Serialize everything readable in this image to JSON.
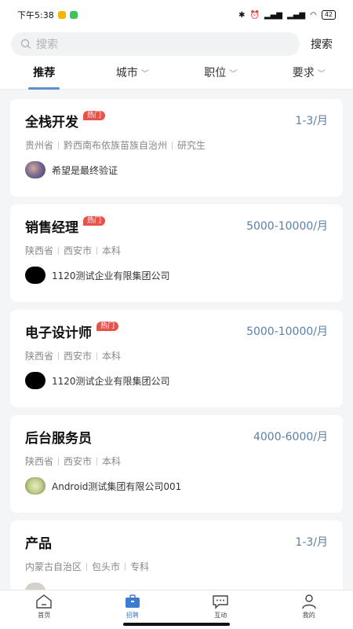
{
  "status_bar": {
    "time": "下午5:38",
    "battery": "42",
    "app_icon_colors": [
      "#f5b400",
      "#3cc35a"
    ]
  },
  "search": {
    "placeholder": "搜索",
    "button_label": "搜索"
  },
  "filter_tabs": [
    {
      "label": "推荐",
      "active": true,
      "has_dropdown": false
    },
    {
      "label": "城市",
      "active": false,
      "has_dropdown": true
    },
    {
      "label": "职位",
      "active": false,
      "has_dropdown": true
    },
    {
      "label": "要求",
      "active": false,
      "has_dropdown": true
    }
  ],
  "jobs": [
    {
      "title": "全栈开发",
      "hot_badge": "热门",
      "salary": "1-3/月",
      "province": "贵州省",
      "city": "黔西南布依族苗族自治州",
      "education": "研究生",
      "company": "希望是最终验证",
      "logo": "sky-photo-logo"
    },
    {
      "title": "销售经理",
      "hot_badge": "热门",
      "salary": "5000-10000/月",
      "province": "陕西省",
      "city": "西安市",
      "education": "本科",
      "company": "1120测试企业有限集团公司",
      "logo": "black-logo"
    },
    {
      "title": "电子设计师",
      "hot_badge": "热门",
      "salary": "5000-10000/月",
      "province": "陕西省",
      "city": "西安市",
      "education": "本科",
      "company": "1120测试企业有限集团公司",
      "logo": "black-logo"
    },
    {
      "title": "后台服务员",
      "hot_badge": "",
      "salary": "4000-6000/月",
      "province": "陕西省",
      "city": "西安市",
      "education": "本科",
      "company": "Android测试集团有限公司001",
      "logo": "food-photo-logo"
    },
    {
      "title": "产品",
      "hot_badge": "",
      "salary": "1-3/月",
      "province": "内蒙古自治区",
      "city": "包头市",
      "education": "专科",
      "company": "",
      "logo": "grey-logo"
    }
  ],
  "bottom_nav": [
    {
      "label": "首页",
      "icon": "home-icon",
      "active": false
    },
    {
      "label": "招聘",
      "icon": "briefcase-icon",
      "active": true
    },
    {
      "label": "互动",
      "icon": "chat-icon",
      "active": false
    },
    {
      "label": "我的",
      "icon": "person-icon",
      "active": false
    }
  ],
  "colors": {
    "accent": "#3b7bd4",
    "salary": "#5b7fa8",
    "hot_badge": "#e8524b",
    "background": "#f4f5f7"
  }
}
